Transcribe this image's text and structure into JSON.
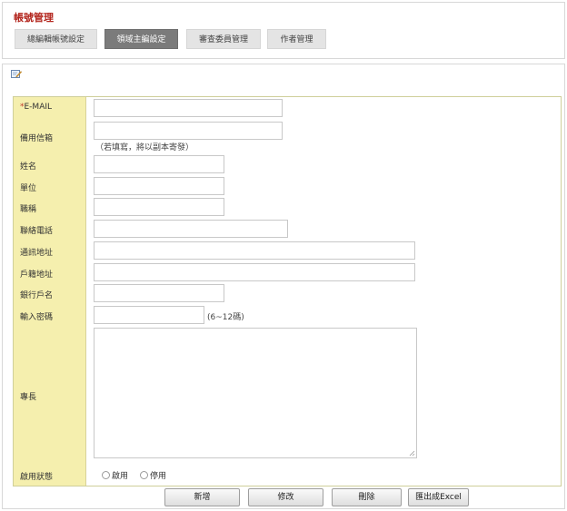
{
  "header": {
    "title": "帳號管理",
    "tabs": [
      {
        "label": "總編輯帳號設定",
        "active": false
      },
      {
        "label": "領域主編設定",
        "active": true
      },
      {
        "label": "審查委員管理",
        "active": false
      },
      {
        "label": "作者管理",
        "active": false
      }
    ]
  },
  "form": {
    "icon": "edit-note-icon",
    "email": {
      "required_mark": "*",
      "label": "E-MAIL",
      "value": ""
    },
    "backup_email": {
      "label": "備用信箱",
      "value": "",
      "hint": "（若填寫，將以副本寄發）"
    },
    "name": {
      "label": "姓名",
      "value": ""
    },
    "unit": {
      "label": "單位",
      "value": ""
    },
    "title": {
      "label": "職稱",
      "value": ""
    },
    "phone": {
      "label": "聯絡電話",
      "value": ""
    },
    "mail_address": {
      "label": "通訊地址",
      "value": ""
    },
    "household_address": {
      "label": "戶籍地址",
      "value": ""
    },
    "bank_account_name": {
      "label": "銀行戶名",
      "value": ""
    },
    "password": {
      "label": "輸入密碼",
      "value": "",
      "hint": "(6~12碼)"
    },
    "expertise": {
      "label": "專長",
      "value": ""
    },
    "status": {
      "label": "啟用狀態",
      "options": [
        {
          "label": "啟用",
          "checked": false
        },
        {
          "label": "停用",
          "checked": false
        }
      ]
    }
  },
  "actions": {
    "add_label": "新增",
    "edit_label": "修改",
    "delete_label": "刪除",
    "export_label": "匯出成Excel"
  },
  "colors": {
    "title_red": "#b3261e",
    "label_bg": "#f5efae",
    "active_tab": "#7b7b7b",
    "tab_bg": "#e4e4e4"
  }
}
